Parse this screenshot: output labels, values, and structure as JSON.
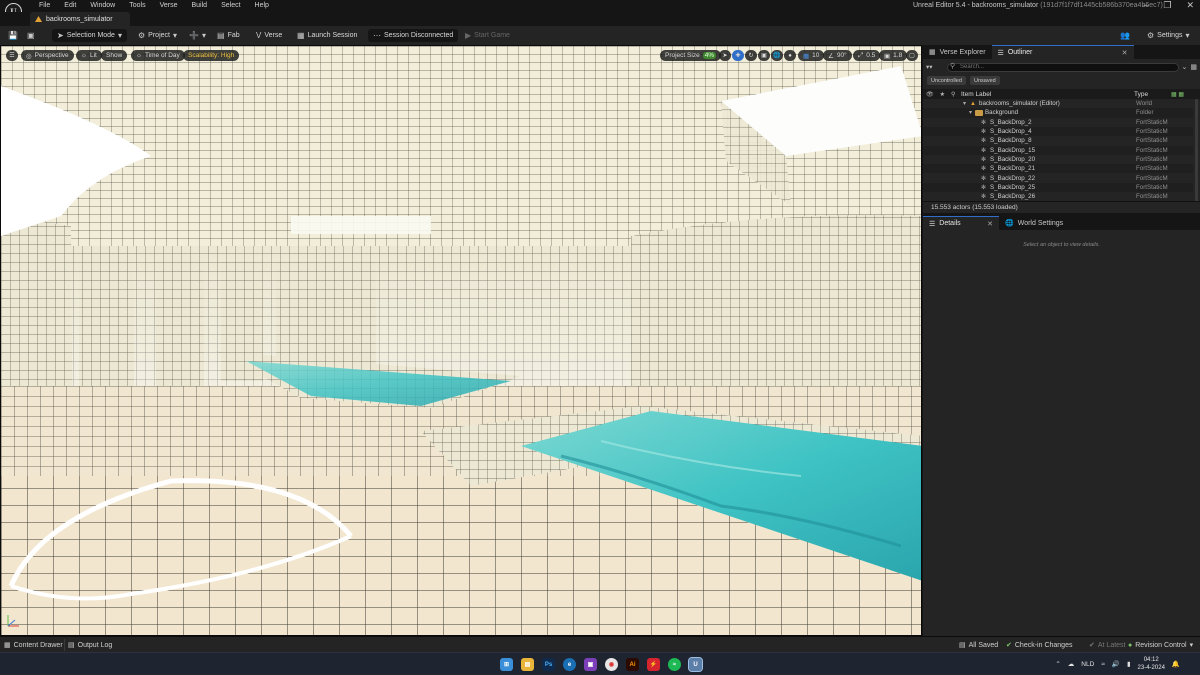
{
  "menu": {
    "items": [
      "File",
      "Edit",
      "Window",
      "Tools",
      "Verse",
      "Build",
      "Select",
      "Help"
    ],
    "window_title": "Unreal Editor 5.4 - backrooms_simulator",
    "window_hash": "(191d7f1f7df1445cb586b370ea4b6ec7)"
  },
  "tabs": {
    "level_tab": "backrooms_simulator"
  },
  "toolbar": {
    "selection_mode": "Selection Mode",
    "project": "Project",
    "fab": "Fab",
    "verse": "Verse",
    "launch_session": "Launch Session",
    "session_status": "Session Disconnected",
    "start_game": "Start Game",
    "settings": "Settings"
  },
  "viewport": {
    "perspective": "Perspective",
    "lit": "Lit",
    "show": "Show",
    "time_of_day": "Time of Day",
    "scalability": "Scalability: High",
    "project_size_label": "Project Size",
    "project_size_value": "4%",
    "grid_snap": "10",
    "rotation_snap": "90°",
    "scale_snap": "0.5",
    "camera_speed": "1.8"
  },
  "outliner": {
    "tab_verse_explorer": "Verse Explorer",
    "tab_outliner": "Outliner",
    "search_placeholder": "Search...",
    "filter_uncontrolled": "Uncontrolled",
    "filter_unsaved": "Unsaved",
    "col_item_label": "Item Label",
    "col_type": "Type",
    "rows": [
      {
        "label": "backrooms_simulator (Editor)",
        "type": "World"
      },
      {
        "label": "Background",
        "type": "Folder"
      },
      {
        "label": "S_BackDrop_2",
        "type": "FortStaticM"
      },
      {
        "label": "S_BackDrop_4",
        "type": "FortStaticM"
      },
      {
        "label": "S_BackDrop_8",
        "type": "FortStaticM"
      },
      {
        "label": "S_BackDrop_15",
        "type": "FortStaticM"
      },
      {
        "label": "S_BackDrop_20",
        "type": "FortStaticM"
      },
      {
        "label": "S_BackDrop_21",
        "type": "FortStaticM"
      },
      {
        "label": "S_BackDrop_22",
        "type": "FortStaticM"
      },
      {
        "label": "S_BackDrop_25",
        "type": "FortStaticM"
      },
      {
        "label": "S_BackDrop_26",
        "type": "FortStaticM"
      }
    ],
    "actor_count": "15.553 actors (15.553 loaded)"
  },
  "details": {
    "tab_details": "Details",
    "tab_world_settings": "World Settings",
    "hint": "Select an object to view details."
  },
  "statusbar": {
    "content_drawer": "Content Drawer",
    "output_log": "Output Log",
    "all_saved": "All Saved",
    "check_in": "Check-in Changes",
    "at_latest": "At Latest",
    "revision_control": "Revision Control"
  },
  "taskbar": {
    "language": "NLD",
    "time": "04:12",
    "date": "23-4-2024"
  },
  "colors": {
    "accent": "#2f6fc9",
    "panel": "#242424",
    "background": "#151515",
    "tile": "#efead7",
    "water": "#3fc3c4"
  }
}
